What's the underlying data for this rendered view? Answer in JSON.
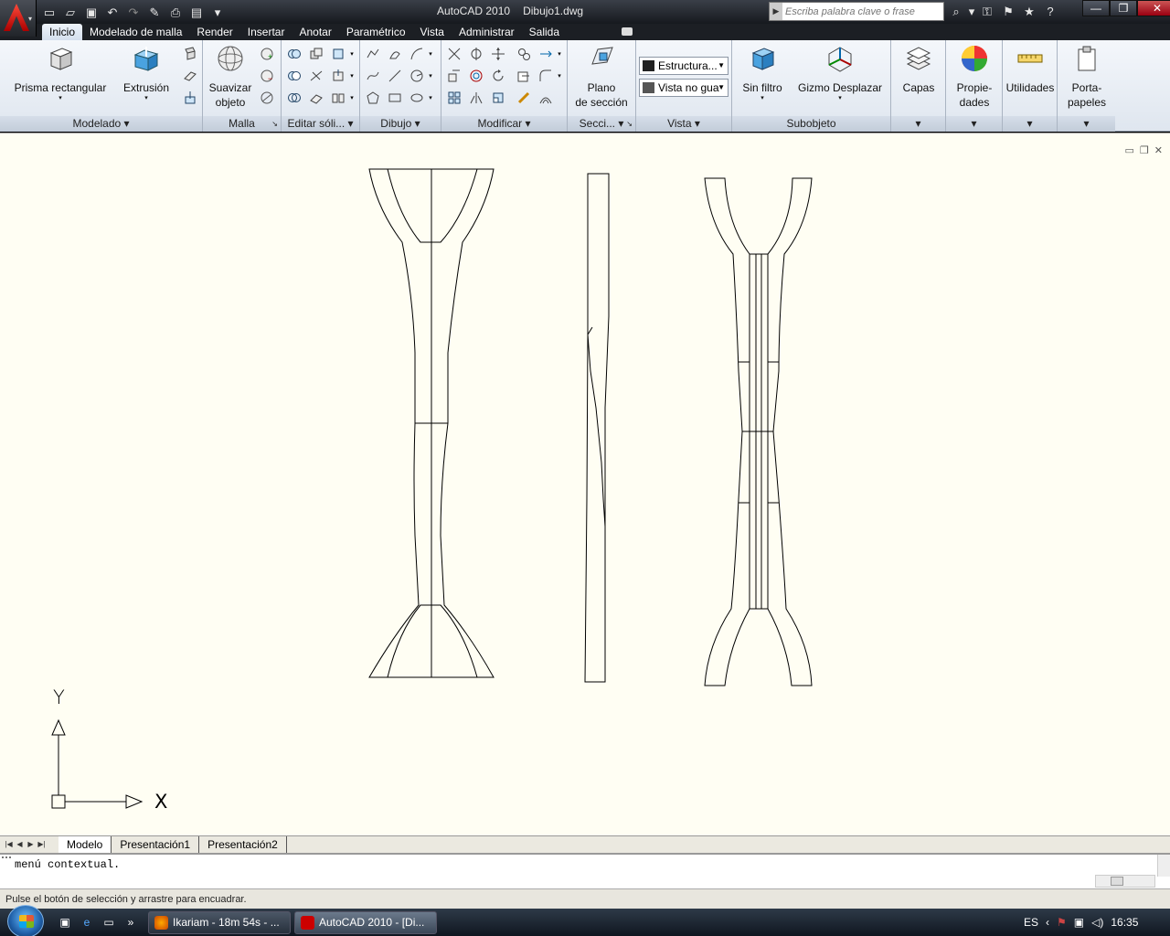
{
  "window": {
    "app_title": "AutoCAD 2010",
    "doc_title": "Dibujo1.dwg"
  },
  "search": {
    "placeholder": "Escriba palabra clave o frase"
  },
  "menu_tabs": [
    "Inicio",
    "Modelado de malla",
    "Render",
    "Insertar",
    "Anotar",
    "Paramétrico",
    "Vista",
    "Administrar",
    "Salida"
  ],
  "ribbon": {
    "modelado": {
      "title": "Modelado ▾",
      "prisma": "Prisma rectangular",
      "extrusion": "Extrusión"
    },
    "malla": {
      "title": "Malla",
      "suavizar1": "Suavizar",
      "suavizar2": "objeto"
    },
    "editar": {
      "title": "Editar sóli... ▾"
    },
    "dibujo": {
      "title": "Dibujo ▾"
    },
    "modificar": {
      "title": "Modificar ▾"
    },
    "seccion": {
      "title": "Secci... ▾",
      "plano1": "Plano",
      "plano2": "de sección"
    },
    "vista": {
      "title": "Vista ▾",
      "combo1": "Estructura...",
      "combo2": "Vista no gua"
    },
    "subobjeto": {
      "title": "Subobjeto",
      "filtro": "Sin filtro",
      "gizmo": "Gizmo Desplazar"
    },
    "capas": "Capas",
    "propiedades1": "Propie-",
    "propiedades2": "dades",
    "utilidades": "Utilidades",
    "portapapeles1": "Porta-",
    "portapapeles2": "papeles"
  },
  "ucs": {
    "x_label": "X",
    "y_label": "Y"
  },
  "layout_tabs": [
    "Modelo",
    "Presentación1",
    "Presentación2"
  ],
  "command_line": {
    "text": "menú contextual."
  },
  "status": {
    "text": "Pulse el botón de selección y arrastre para encuadrar."
  },
  "taskbar": {
    "task1": "Ikariam - 18m 54s - ...",
    "task2": "AutoCAD 2010 - [Di...",
    "lang": "ES",
    "time": "16:35"
  },
  "colors": {
    "drawing_bg": "#fffef3",
    "accent": "#c00000"
  }
}
